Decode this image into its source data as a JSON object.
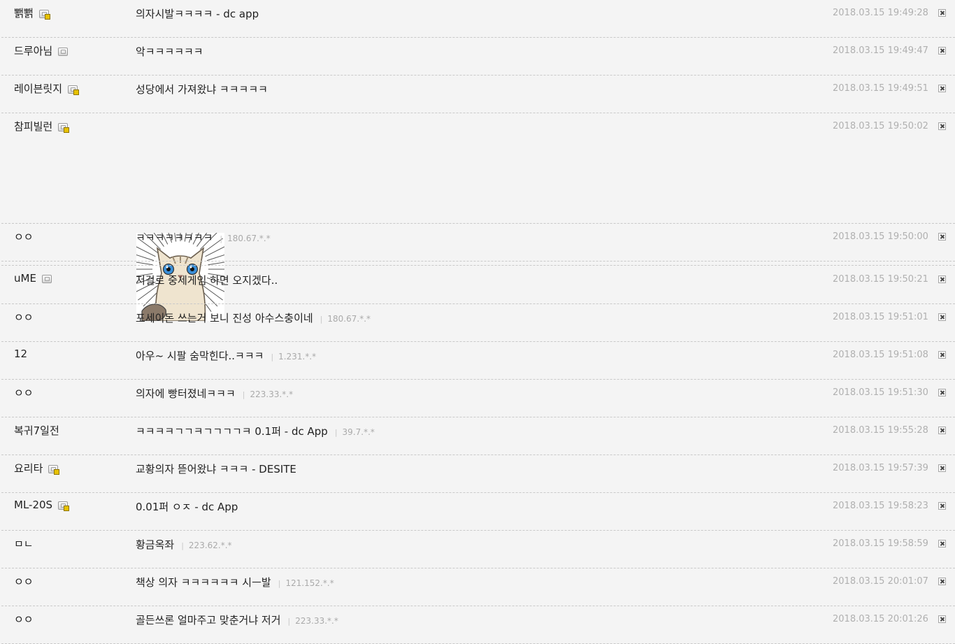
{
  "comments": [
    {
      "nick": "뾁뾁",
      "gallog": "fixed",
      "memo": "의자시발ㅋㅋㅋㅋ - dc app",
      "ip": "",
      "date": "2018.03.15 19:49:28"
    },
    {
      "nick": "드루아님",
      "gallog": "plain",
      "memo": "악ㅋㅋㅋㅋㅋㅋ",
      "ip": "",
      "date": "2018.03.15 19:49:47"
    },
    {
      "nick": "레이븐릿지",
      "gallog": "fixed",
      "memo": "성당에서 가져왔냐 ㅋㅋㅋㅋㅋ",
      "ip": "",
      "date": "2018.03.15 19:49:51"
    },
    {
      "nick": "참피빌런",
      "gallog": "fixed",
      "memo": "",
      "ip": "",
      "date": "2018.03.15 19:50:02",
      "emoticon": "surprised-cat-emoticon"
    },
    {
      "nick": "ㅇㅇ",
      "gallog": "",
      "memo": "ㅋㅋㅋㅋㅋㅋㅋㅋ",
      "ip": "180.67.*.*",
      "date": "2018.03.15 19:50:00"
    },
    {
      "nick": "uME",
      "gallog": "plain",
      "memo": "저걸로 중세게임 하면 오지겠다..",
      "ip": "",
      "date": "2018.03.15 19:50:21"
    },
    {
      "nick": "ㅇㅇ",
      "gallog": "",
      "memo": "포세이돈 쓰는거 보니 진성 아수스충이네",
      "ip": "180.67.*.*",
      "date": "2018.03.15 19:51:01"
    },
    {
      "nick": "12",
      "gallog": "",
      "memo": "아우~ 시팔 숨막힌다..ㅋㅋㅋ",
      "ip": "1.231.*.*",
      "date": "2018.03.15 19:51:08"
    },
    {
      "nick": "ㅇㅇ",
      "gallog": "",
      "memo": "의자에 빵터졌네ㅋㅋㅋ",
      "ip": "223.33.*.*",
      "date": "2018.03.15 19:51:30"
    },
    {
      "nick": "복귀7일전",
      "gallog": "",
      "memo": "ㅋㅋㅋㅋㄱㄱㅋㄱㄱㄱㄱㅋ 0.1퍼 - dc App",
      "ip": "39.7.*.*",
      "date": "2018.03.15 19:55:28"
    },
    {
      "nick": "요리타",
      "gallog": "fixed",
      "memo": "교황의자 뜯어왔냐 ㅋㅋㅋ - DESITE",
      "ip": "",
      "date": "2018.03.15 19:57:39"
    },
    {
      "nick": "ML-20S",
      "gallog": "fixed",
      "memo": "0.01퍼 ㅇㅈ - dc App",
      "ip": "",
      "date": "2018.03.15 19:58:23"
    },
    {
      "nick": "ㅁㄴ",
      "gallog": "",
      "memo": "황금옥좌",
      "ip": "223.62.*.*",
      "date": "2018.03.15 19:58:59"
    },
    {
      "nick": "ㅇㅇ",
      "gallog": "",
      "memo": "책상 의자 ㅋㅋㅋㅋㅋㅋ 시ㅡ발",
      "ip": "121.152.*.*",
      "date": "2018.03.15 20:01:07"
    },
    {
      "nick": "ㅇㅇ",
      "gallog": "",
      "memo": "골든쓰론 얼마주고 맞춘거냐 저거",
      "ip": "223.33.*.*",
      "date": "2018.03.15 20:01:26"
    }
  ],
  "colors": {
    "background": "#f4f4f4",
    "text": "#222222",
    "meta": "#b0b0b0",
    "divider": "#c9c9c9"
  },
  "icons": {
    "gallog": "gallog-icon",
    "delete": "delete-comment-icon"
  }
}
